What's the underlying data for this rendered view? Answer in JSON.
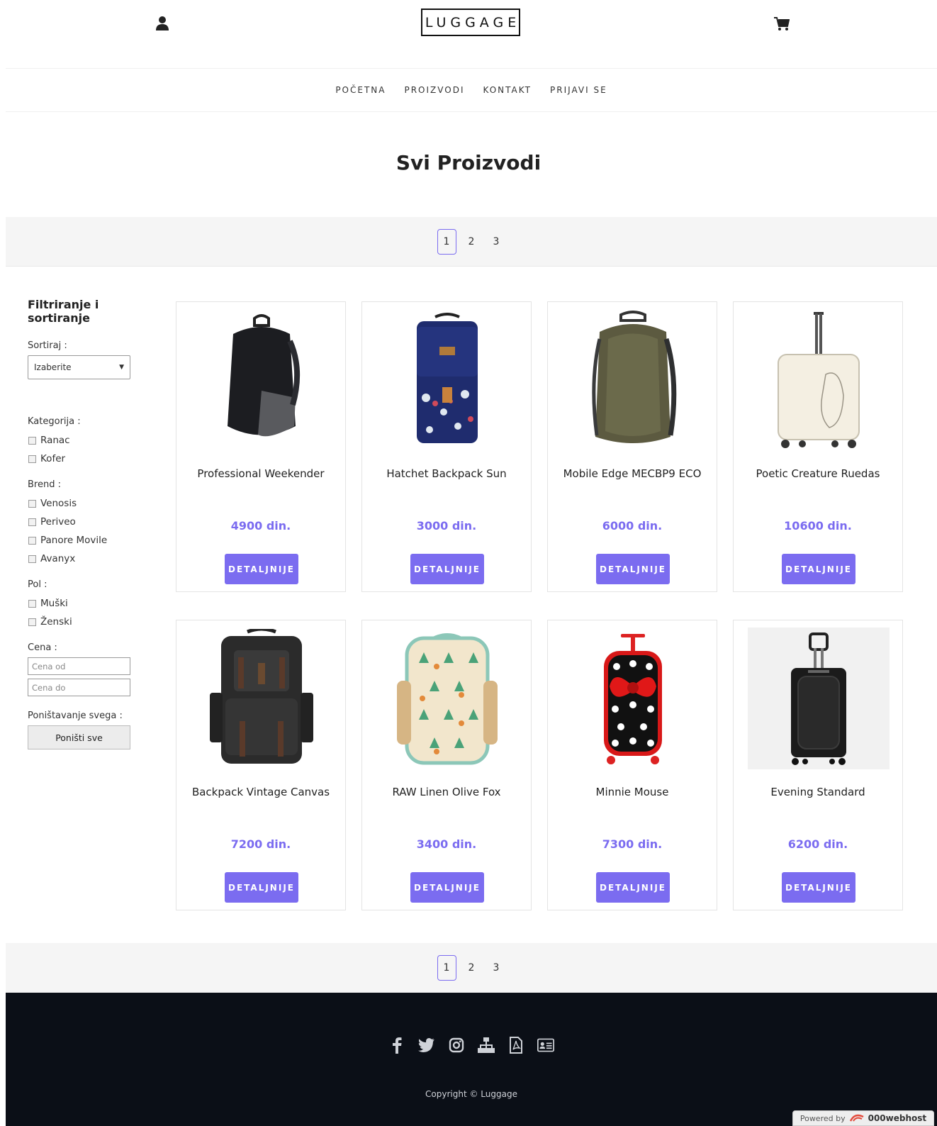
{
  "header": {
    "logo": "LUGGAGE",
    "user_icon": "user-icon",
    "cart_icon": "cart-icon"
  },
  "nav": [
    {
      "label": "POČETNA"
    },
    {
      "label": "PROIZVODI"
    },
    {
      "label": "KONTAKT"
    },
    {
      "label": "PRIJAVI SE"
    }
  ],
  "page_title": "Svi Proizvodi",
  "pagination": {
    "pages": [
      "1",
      "2",
      "3"
    ],
    "active": "1"
  },
  "sidebar": {
    "title": "Filtriranje i sortiranje",
    "sort_label": "Sortiraj :",
    "sort_value": "Izaberite",
    "category_label": "Kategorija :",
    "categories": [
      "Ranac",
      "Kofer"
    ],
    "brand_label": "Brend :",
    "brands": [
      "Venosis",
      "Periveo",
      "Panore Movile",
      "Avanyx"
    ],
    "gender_label": "Pol :",
    "genders": [
      "Muški",
      "Ženski"
    ],
    "price_label": "Cena :",
    "price_from_placeholder": "Cena od",
    "price_to_placeholder": "Cena do",
    "reset_label": "Poništavanje svega :",
    "reset_button": "Poništi sve"
  },
  "products": [
    {
      "name": "Professional Weekender",
      "price": "4900 din.",
      "button": "DETALJNIJE",
      "kind": "backpack-black"
    },
    {
      "name": "Hatchet Backpack Sun",
      "price": "3000 din.",
      "button": "DETALJNIJE",
      "kind": "backpack-navy"
    },
    {
      "name": "Mobile Edge MECBP9 ECO",
      "price": "6000 din.",
      "button": "DETALJNIJE",
      "kind": "backpack-olive"
    },
    {
      "name": "Poetic Creature Ruedas",
      "price": "10600 din.",
      "button": "DETALJNIJE",
      "kind": "suitcase-cream"
    },
    {
      "name": "Backpack Vintage Canvas",
      "price": "7200 din.",
      "button": "DETALJNIJE",
      "kind": "backpack-canvas"
    },
    {
      "name": "RAW Linen Olive Fox",
      "price": "3400 din.",
      "button": "DETALJNIJE",
      "kind": "backpack-fox"
    },
    {
      "name": "Minnie Mouse",
      "price": "7300 din.",
      "button": "DETALJNIJE",
      "kind": "suitcase-minnie"
    },
    {
      "name": "Evening Standard",
      "price": "6200 din.",
      "button": "DETALJNIJE",
      "kind": "suitcase-black"
    }
  ],
  "footer": {
    "socials": [
      "facebook-icon",
      "twitter-icon",
      "instagram-icon",
      "sitemap-icon",
      "pdf-icon",
      "id-card-icon"
    ],
    "copyright": "Copyright © Luggage",
    "powered_prefix": "Powered by",
    "powered_brand": "000webhost"
  },
  "colors": {
    "accent": "#7b6cf0",
    "footer_bg": "#0b0f17",
    "pagination_bg": "#f5f5f5"
  }
}
